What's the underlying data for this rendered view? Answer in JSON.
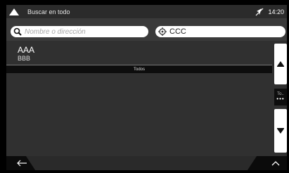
{
  "status_bar": {
    "title": "Buscar en todo",
    "time": "14:20",
    "home_icon": "home-triangle-icon",
    "gps_icon": "no-gps-icon"
  },
  "search": {
    "name_placeholder": "Nombre o dirección",
    "location_value": "CCC"
  },
  "results": [
    {
      "title": "AAA",
      "subtitle": "BBB"
    }
  ],
  "filter": {
    "label": "Todos"
  },
  "scroll": {
    "indicator_label": "To..",
    "indicator_dots": "•••"
  },
  "colors": {
    "panel": "#303030",
    "header": "#2b2b2b",
    "accent": "#ffffff"
  }
}
